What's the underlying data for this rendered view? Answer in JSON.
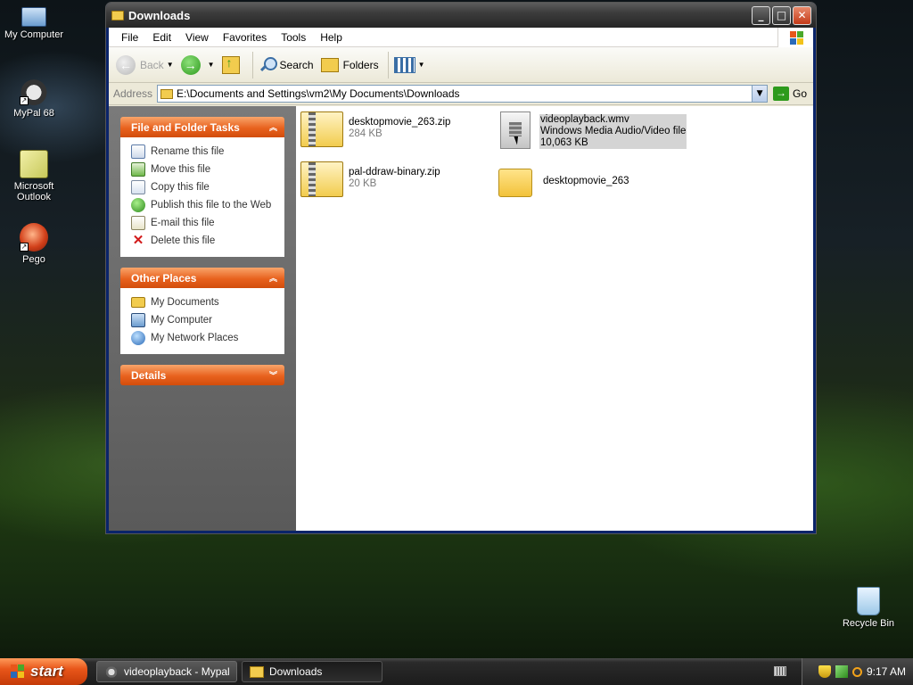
{
  "desktop": {
    "icons": [
      {
        "label": "My Computer"
      },
      {
        "label": "MyPal 68"
      },
      {
        "label": "Microsoft Outlook"
      },
      {
        "label": "Pego"
      },
      {
        "label": "Recycle Bin"
      }
    ]
  },
  "window": {
    "title": "Downloads",
    "menu": [
      "File",
      "Edit",
      "View",
      "Favorites",
      "Tools",
      "Help"
    ],
    "toolbar": {
      "back": "Back",
      "search": "Search",
      "folders": "Folders"
    },
    "address": {
      "label": "Address",
      "value": "E:\\Documents and Settings\\vm2\\My Documents\\Downloads",
      "go": "Go"
    },
    "panels": {
      "file_tasks": {
        "title": "File and Folder Tasks",
        "items": [
          "Rename this file",
          "Move this file",
          "Copy this file",
          "Publish this file to the Web",
          "E-mail this file",
          "Delete this file"
        ]
      },
      "other_places": {
        "title": "Other Places",
        "items": [
          "My Documents",
          "My Computer",
          "My Network Places"
        ]
      },
      "details": {
        "title": "Details"
      }
    },
    "files": [
      {
        "name": "desktopmovie_263.zip",
        "meta": "284 KB"
      },
      {
        "name": "videoplayback.wmv",
        "type": "Windows Media Audio/Video file",
        "meta": "10,063 KB"
      },
      {
        "name": "pal-ddraw-binary.zip",
        "meta": "20 KB"
      },
      {
        "name": "desktopmovie_263"
      }
    ]
  },
  "taskbar": {
    "start": "start",
    "buttons": [
      "videoplayback - Mypal",
      "Downloads"
    ],
    "clock": "9:17 AM"
  },
  "colors": {
    "task_panel_header": "#e8621e",
    "title_bar": "#3c3c3c",
    "selection": "#d4d4d4"
  }
}
